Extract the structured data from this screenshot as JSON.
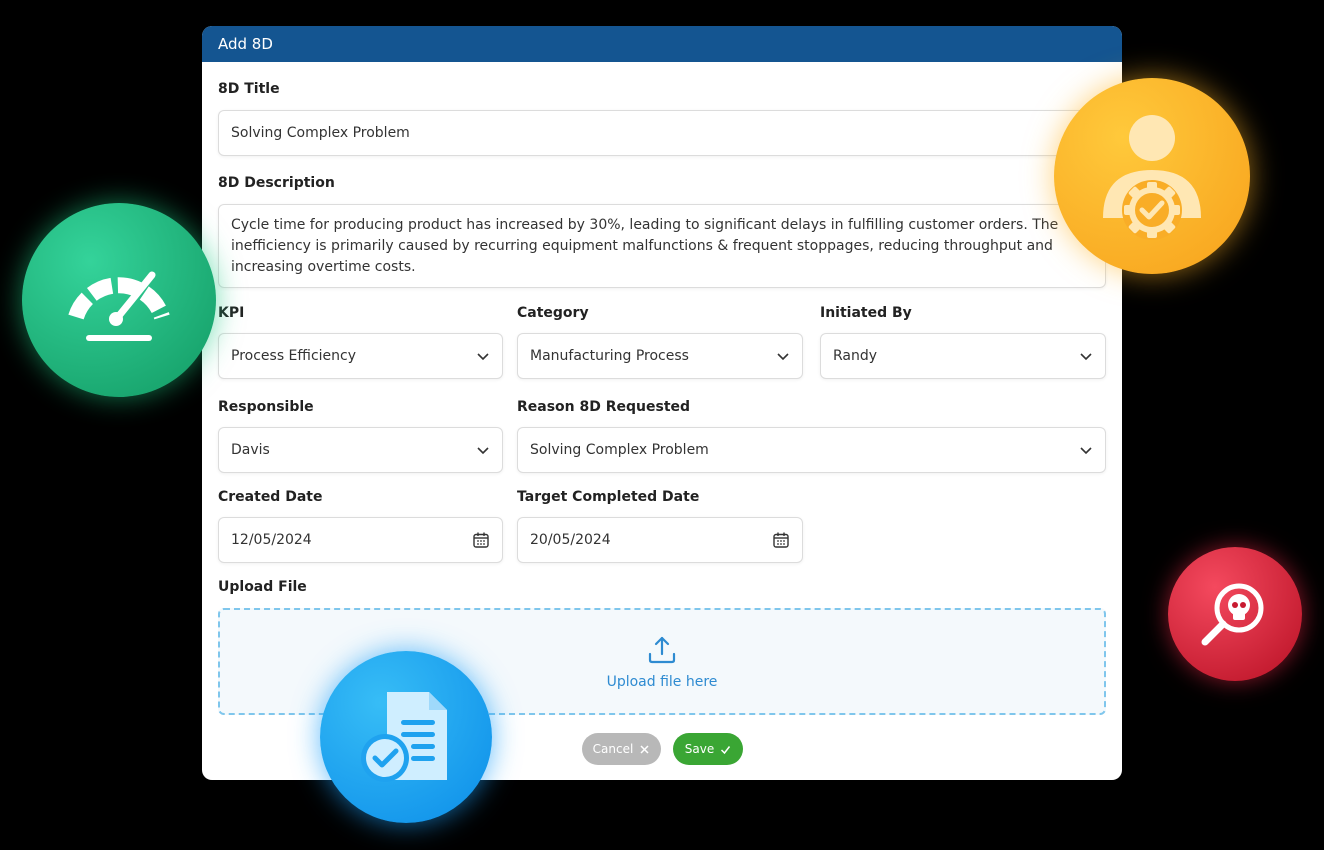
{
  "dialog": {
    "title": "Add 8D"
  },
  "form": {
    "title_label": "8D Title",
    "title_value": "Solving Complex Problem",
    "description_label": "8D Description",
    "description_value": "Cycle time for producing product has increased by 30%, leading to significant delays in fulfilling customer orders. The inefficiency is primarily caused by recurring equipment malfunctions & frequent stoppages, reducing throughput and increasing overtime costs.",
    "kpi_label": "KPI",
    "kpi_value": "Process Efficiency",
    "category_label": "Category",
    "category_value": "Manufacturing Process",
    "initiated_by_label": "Initiated By",
    "initiated_by_value": "Randy",
    "responsible_label": "Responsible",
    "responsible_value": "Davis",
    "reason_label": "Reason 8D Requested",
    "reason_value": "Solving Complex Problem",
    "created_date_label": "Created Date",
    "created_date_value": "12/05/2024",
    "target_date_label": "Target Completed Date",
    "target_date_value": "20/05/2024",
    "upload_label": "Upload File",
    "upload_text": "Upload file here"
  },
  "buttons": {
    "cancel": "Cancel",
    "save": "Save"
  },
  "colors": {
    "header_bg": "#145591",
    "save": "#3aa634",
    "cancel": "#b8b8b8",
    "upload_link": "#2e8bd1"
  },
  "decorations": {
    "green": "speedometer-icon",
    "orange": "user-gear-icon",
    "red": "search-skull-icon",
    "blue": "document-check-icon"
  }
}
